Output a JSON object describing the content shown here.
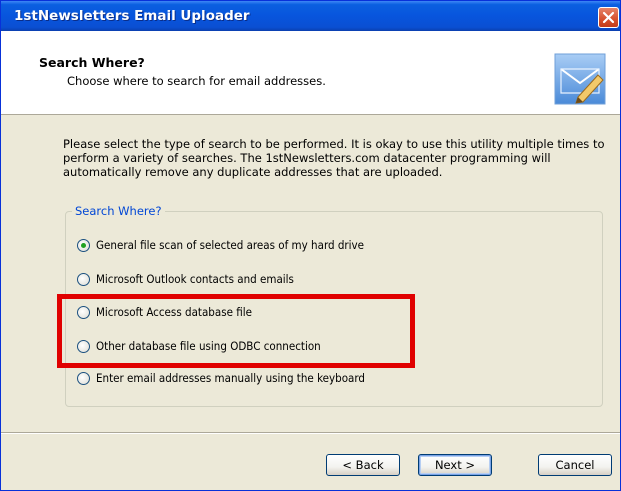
{
  "window": {
    "title": "1stNewsletters Email Uploader"
  },
  "header": {
    "title": "Search Where?",
    "subtitle": "Choose where to search for email addresses.",
    "icon": "envelope-pencil-icon"
  },
  "body": {
    "intro": "Please select the type of search to be performed. It is okay to use this utility multiple times to perform a variety of searches. The 1stNewsletters.com datacenter programming will automatically remove any duplicate addresses that are uploaded."
  },
  "search_group": {
    "legend": "Search Where?",
    "options": [
      {
        "label": "General file scan of selected areas of my hard drive",
        "checked": true
      },
      {
        "label": "Microsoft Outlook contacts and emails",
        "checked": false
      },
      {
        "label": "Microsoft Access database file",
        "checked": false
      },
      {
        "label": "Other database file using ODBC connection",
        "checked": false
      },
      {
        "label": "Enter email addresses manually using the keyboard",
        "checked": false
      }
    ]
  },
  "buttons": {
    "back": "< Back",
    "next": "Next >",
    "cancel": "Cancel"
  },
  "colors": {
    "titlebar": "#0855dd",
    "dialog_bg": "#ece9d8",
    "group_legend": "#0046d5",
    "highlight": "#e00000",
    "radio_selected": "#21a121"
  }
}
